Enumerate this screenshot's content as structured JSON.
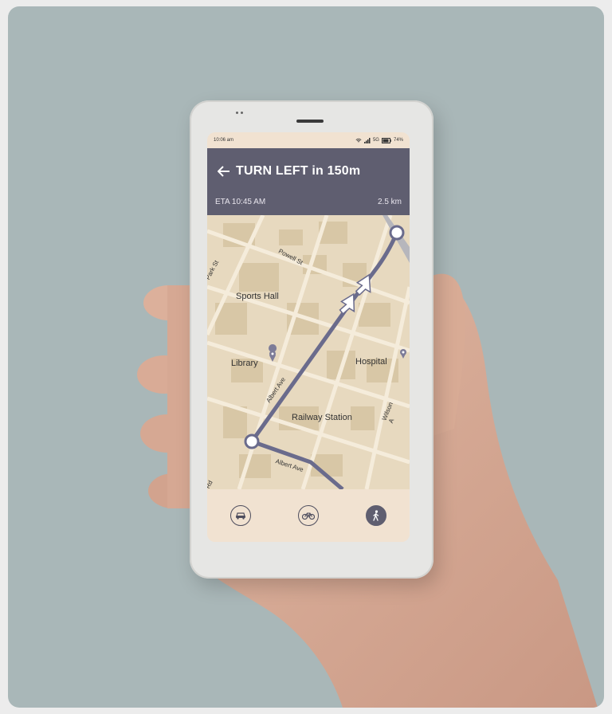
{
  "status_bar": {
    "time": "10:06 am",
    "network": "5G",
    "battery": "74%"
  },
  "navigation": {
    "instruction": "TURN LEFT in 150m",
    "eta": "ETA 10:45 AM",
    "distance": "2.5 km"
  },
  "map": {
    "places": {
      "sports_hall": "Sports Hall",
      "library": "Library",
      "hospital": "Hospital",
      "railway_station": "Railway Station"
    },
    "streets": {
      "powell": "Powell St",
      "park": "Park St",
      "albert_upper": "Albert Ave",
      "albert_lower": "Albert Ave",
      "wilson": "Wilson A",
      "rd": "Rd"
    }
  },
  "modes": [
    {
      "name": "car",
      "icon": "car-icon",
      "active": false
    },
    {
      "name": "bike",
      "icon": "bicycle-icon",
      "active": false
    },
    {
      "name": "walk",
      "icon": "walking-person-icon",
      "active": true
    }
  ],
  "colors": {
    "header": "#5f5e70",
    "route": "#6a6b8c",
    "screen_bg": "#f1e2d1",
    "map_bg": "#e7d9bf"
  }
}
